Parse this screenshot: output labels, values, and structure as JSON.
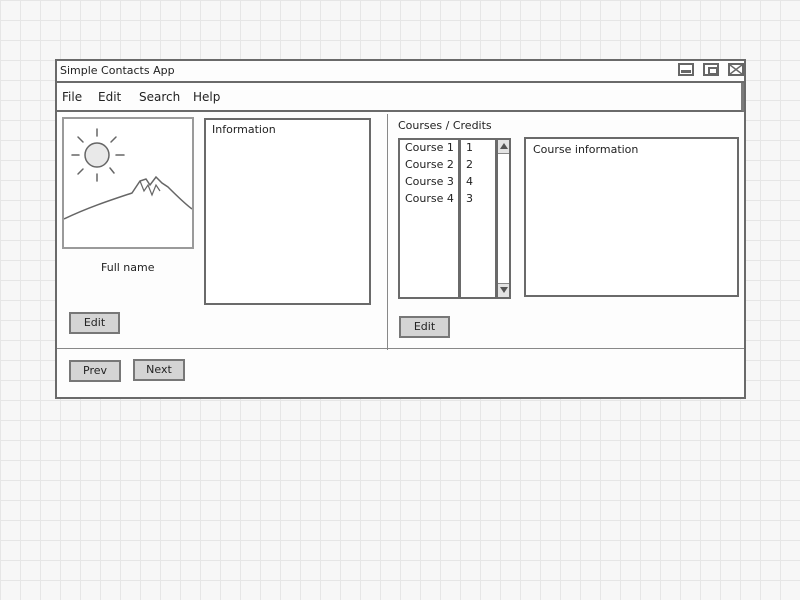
{
  "window": {
    "title": "Simple Contacts App"
  },
  "menu": {
    "items": [
      "File",
      "Edit",
      "Search",
      "Help"
    ]
  },
  "contact": {
    "full_name_label": "Full name",
    "information_label": "Information",
    "edit_label": "Edit"
  },
  "courses": {
    "header": "Courses / Credits",
    "rows": [
      {
        "course": "Course 1",
        "credits": "1"
      },
      {
        "course": "Course 2",
        "credits": "2"
      },
      {
        "course": "Course 3",
        "credits": "4"
      },
      {
        "course": "Course 4",
        "credits": "3"
      }
    ],
    "info_label": "Course information",
    "edit_label": "Edit"
  },
  "navigation": {
    "prev_label": "Prev",
    "next_label": "Next"
  },
  "icons": {
    "minimize": "minimize-icon",
    "maximize": "maximize-icon",
    "close": "close-icon",
    "scroll_up": "arrow-up-icon",
    "scroll_down": "arrow-down-icon",
    "photo": "image-placeholder-icon"
  },
  "colors": {
    "background": "#f7f7f7",
    "grid": "#e6e6e6",
    "button": "#d4d4d4",
    "border": "#6a6a6a"
  }
}
